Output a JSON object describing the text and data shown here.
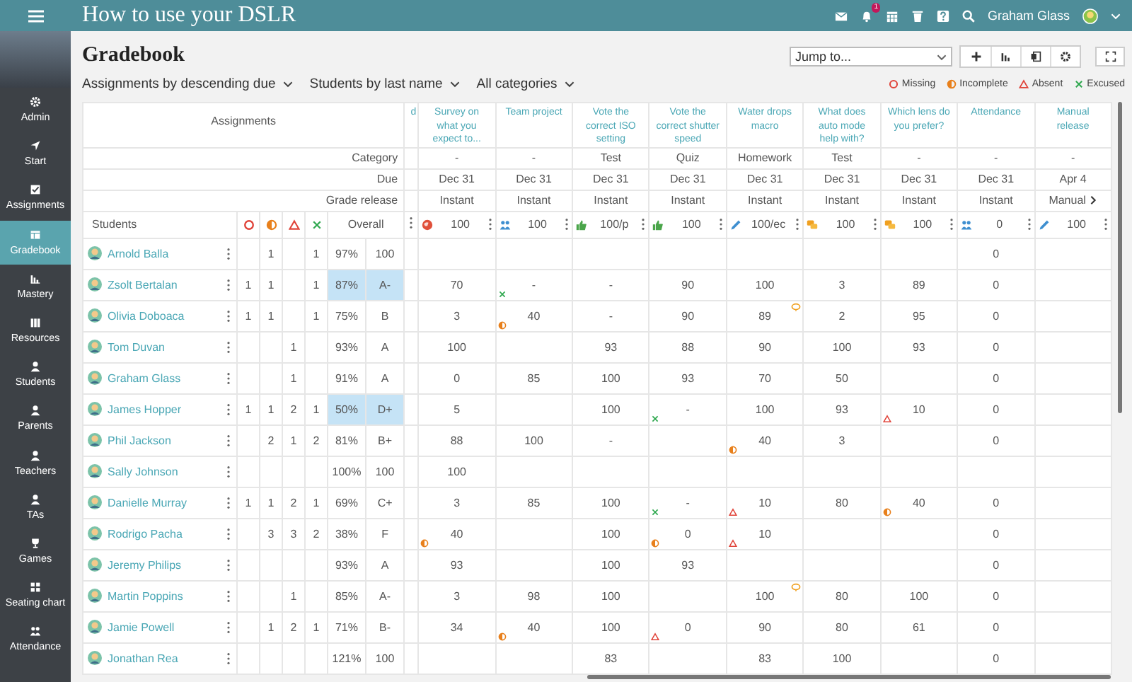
{
  "topbar": {
    "title": "How to use your DSLR",
    "notification_count": "1",
    "user_name": "Graham Glass"
  },
  "sidebar": {
    "items": [
      {
        "label": "Admin",
        "selected": false
      },
      {
        "label": "Start",
        "selected": false
      },
      {
        "label": "Assignments",
        "selected": false
      },
      {
        "label": "Gradebook",
        "selected": true
      },
      {
        "label": "Mastery",
        "selected": false
      },
      {
        "label": "Resources",
        "selected": false
      },
      {
        "label": "Students",
        "selected": false
      },
      {
        "label": "Parents",
        "selected": false
      },
      {
        "label": "Teachers",
        "selected": false
      },
      {
        "label": "TAs",
        "selected": false
      },
      {
        "label": "Games",
        "selected": false
      },
      {
        "label": "Seating chart",
        "selected": false
      },
      {
        "label": "Attendance",
        "selected": false
      }
    ]
  },
  "page": {
    "title": "Gradebook",
    "filters": [
      "Assignments by descending due",
      "Students by last name",
      "All categories"
    ],
    "jump_select": {
      "value": "Jump to..."
    }
  },
  "legend": [
    {
      "kind": "missing",
      "label": "Missing"
    },
    {
      "kind": "incomplete",
      "label": "Incomplete"
    },
    {
      "kind": "absent",
      "label": "Absent"
    },
    {
      "kind": "excused",
      "label": "Excused"
    }
  ],
  "gradebook": {
    "labels": {
      "assignments": "Assignments",
      "category": "Category",
      "due": "Due",
      "grade_release": "Grade release",
      "students": "Students",
      "overall": "Overall"
    },
    "cut_column": {
      "title": "d"
    },
    "assignments": [
      {
        "title": "Survey on what you expect to...",
        "kind": "survey",
        "category": "-",
        "due": "Dec 31",
        "release": "Instant",
        "expandable": false,
        "points": "100"
      },
      {
        "title": "Team project",
        "kind": "group",
        "category": "-",
        "due": "Dec 31",
        "release": "Instant",
        "expandable": false,
        "points": "100"
      },
      {
        "title": "Vote the correct ISO setting",
        "kind": "poll",
        "category": "Test",
        "due": "Dec 31",
        "release": "Instant",
        "expandable": false,
        "points": "100/p"
      },
      {
        "title": "Vote the correct shutter speed",
        "kind": "poll",
        "category": "Quiz",
        "due": "Dec 31",
        "release": "Instant",
        "expandable": false,
        "points": "100"
      },
      {
        "title": "Water drops macro",
        "kind": "essay",
        "category": "Homework",
        "due": "Dec 31",
        "release": "Instant",
        "expandable": false,
        "points": "100/ec"
      },
      {
        "title": "What does auto mode help with?",
        "kind": "discussion",
        "category": "Test",
        "due": "Dec 31",
        "release": "Instant",
        "expandable": false,
        "points": "100"
      },
      {
        "title": "Which lens do you prefer?",
        "kind": "discussion",
        "category": "-",
        "due": "Dec 31",
        "release": "Instant",
        "expandable": false,
        "points": "100"
      },
      {
        "title": "Attendance",
        "kind": "attendance",
        "category": "-",
        "due": "Dec 31",
        "release": "Instant",
        "expandable": false,
        "points": "0"
      },
      {
        "title": "Manual release",
        "kind": "essay",
        "category": "-",
        "due": "Apr 4",
        "release": "Manual",
        "expandable": true,
        "points": "100"
      }
    ],
    "students": [
      {
        "name": "Arnold Balla",
        "counts": {
          "incomplete": "1",
          "excused": "1"
        },
        "percent": "97%",
        "grade": "100",
        "highlighted": false,
        "cells": [
          null,
          null,
          null,
          null,
          null,
          null,
          null,
          {
            "value": "0"
          },
          null
        ]
      },
      {
        "name": "Zsolt Bertalan",
        "counts": {
          "missing": "1",
          "incomplete": "1",
          "excused": "1"
        },
        "percent": "87%",
        "grade": "A-",
        "highlighted": true,
        "cells": [
          {
            "value": "70"
          },
          {
            "value": "-",
            "kind": "excused"
          },
          {
            "value": "-"
          },
          {
            "value": "90"
          },
          {
            "value": "100"
          },
          {
            "value": "3"
          },
          {
            "value": "89"
          },
          {
            "value": "0"
          },
          null
        ]
      },
      {
        "name": "Olivia Doboaca",
        "counts": {
          "missing": "1",
          "incomplete": "1",
          "excused": "1"
        },
        "percent": "75%",
        "grade": "B",
        "highlighted": false,
        "cells": [
          {
            "value": "3"
          },
          {
            "value": "40",
            "kind": "incomplete"
          },
          {
            "value": "-"
          },
          {
            "value": "90"
          },
          {
            "value": "89",
            "kind": "comment"
          },
          {
            "value": "2"
          },
          {
            "value": "95"
          },
          {
            "value": "0"
          },
          null
        ]
      },
      {
        "name": "Tom Duvan",
        "counts": {
          "absent": "1"
        },
        "percent": "93%",
        "grade": "A",
        "highlighted": false,
        "cells": [
          {
            "value": "100"
          },
          null,
          {
            "value": "93"
          },
          {
            "value": "88"
          },
          {
            "value": "90"
          },
          {
            "value": "100"
          },
          {
            "value": "93"
          },
          {
            "value": "0"
          },
          null
        ]
      },
      {
        "name": "Graham Glass",
        "counts": {
          "absent": "1"
        },
        "percent": "91%",
        "grade": "A",
        "highlighted": false,
        "cells": [
          {
            "value": "0"
          },
          {
            "value": "85"
          },
          {
            "value": "100"
          },
          {
            "value": "93"
          },
          {
            "value": "70"
          },
          {
            "value": "50"
          },
          null,
          {
            "value": "0"
          },
          null
        ]
      },
      {
        "name": "James Hopper",
        "counts": {
          "missing": "1",
          "incomplete": "1",
          "absent": "2",
          "excused": "1"
        },
        "percent": "50%",
        "grade": "D+",
        "highlighted": true,
        "cells": [
          {
            "value": "5"
          },
          null,
          {
            "value": "100"
          },
          {
            "value": "-",
            "kind": "excused"
          },
          {
            "value": "100"
          },
          {
            "value": "93"
          },
          {
            "value": "10",
            "kind": "absent"
          },
          {
            "value": "0"
          },
          null
        ]
      },
      {
        "name": "Phil Jackson",
        "counts": {
          "incomplete": "2",
          "absent": "1",
          "excused": "2"
        },
        "percent": "81%",
        "grade": "B+",
        "highlighted": false,
        "cells": [
          {
            "value": "88"
          },
          {
            "value": "100"
          },
          {
            "value": "-"
          },
          null,
          {
            "value": "40",
            "kind": "incomplete"
          },
          {
            "value": "3"
          },
          null,
          {
            "value": "0"
          },
          null
        ]
      },
      {
        "name": "Sally Johnson",
        "percent": "100%",
        "grade": "100",
        "highlighted": false,
        "cells": [
          {
            "value": "100"
          },
          null,
          null,
          null,
          null,
          null,
          null,
          null,
          null
        ]
      },
      {
        "name": "Danielle Murray",
        "counts": {
          "missing": "1",
          "incomplete": "1",
          "absent": "2",
          "excused": "1"
        },
        "percent": "69%",
        "grade": "C+",
        "highlighted": false,
        "cells": [
          {
            "value": "3"
          },
          {
            "value": "85"
          },
          {
            "value": "100"
          },
          {
            "value": "-",
            "kind": "excused"
          },
          {
            "value": "10",
            "kind": "absent"
          },
          {
            "value": "80"
          },
          {
            "value": "40",
            "kind": "incomplete"
          },
          {
            "value": "0"
          },
          null
        ]
      },
      {
        "name": "Rodrigo Pacha",
        "counts": {
          "incomplete": "3",
          "absent": "3",
          "excused": "2"
        },
        "percent": "38%",
        "grade": "F",
        "highlighted": false,
        "cells": [
          {
            "value": "40",
            "kind": "incomplete"
          },
          null,
          {
            "value": "100"
          },
          {
            "value": "0",
            "kind": "incomplete"
          },
          {
            "value": "10",
            "kind": "absent"
          },
          null,
          null,
          {
            "value": "0"
          },
          null
        ]
      },
      {
        "name": "Jeremy Philips",
        "percent": "93%",
        "grade": "A",
        "highlighted": false,
        "cells": [
          {
            "value": "93"
          },
          null,
          {
            "value": "100"
          },
          {
            "value": "93"
          },
          null,
          null,
          null,
          {
            "value": "0"
          },
          null
        ]
      },
      {
        "name": "Martin Poppins",
        "counts": {
          "absent": "1"
        },
        "percent": "85%",
        "grade": "A-",
        "highlighted": false,
        "cells": [
          {
            "value": "3"
          },
          {
            "value": "98"
          },
          {
            "value": "100"
          },
          null,
          {
            "value": "100",
            "kind": "comment"
          },
          {
            "value": "80"
          },
          {
            "value": "100"
          },
          {
            "value": "0"
          },
          null
        ]
      },
      {
        "name": "Jamie Powell",
        "counts": {
          "incomplete": "1",
          "absent": "2",
          "excused": "1"
        },
        "percent": "71%",
        "grade": "B-",
        "highlighted": false,
        "cells": [
          {
            "value": "34"
          },
          {
            "value": "40",
            "kind": "incomplete"
          },
          {
            "value": "100"
          },
          {
            "value": "0",
            "kind": "absent"
          },
          {
            "value": "90"
          },
          {
            "value": "80"
          },
          {
            "value": "61"
          },
          {
            "value": "0"
          },
          null
        ]
      },
      {
        "name": "Jonathan Rea",
        "percent": "121%",
        "grade": "100",
        "highlighted": false,
        "cells": [
          null,
          null,
          {
            "value": "83"
          },
          null,
          {
            "value": "83"
          },
          {
            "value": "100"
          },
          null,
          {
            "value": "0"
          },
          null
        ]
      }
    ]
  }
}
